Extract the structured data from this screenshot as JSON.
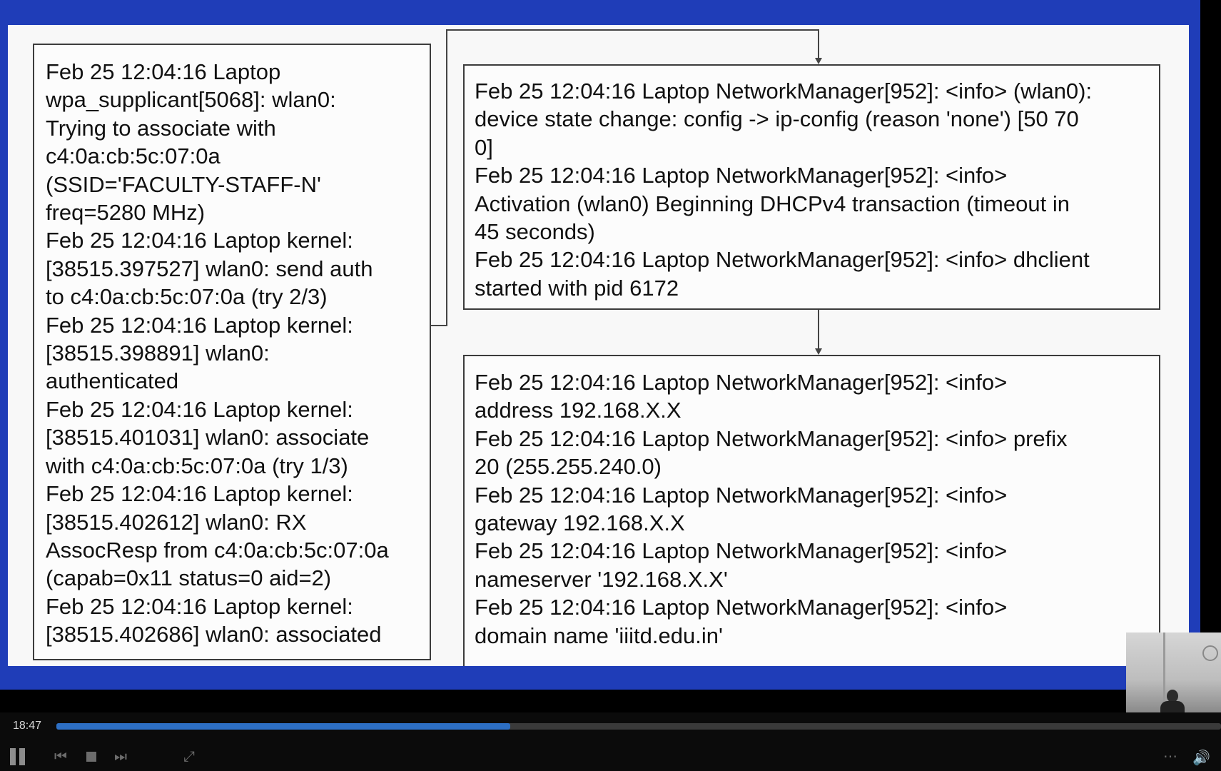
{
  "slide": {
    "left_box": [
      "Feb 25 12:04:16 Laptop",
      "wpa_supplicant[5068]: wlan0:",
      "Trying to associate with",
      "c4:0a:cb:5c:07:0a",
      "(SSID='FACULTY-STAFF-N'",
      "freq=5280 MHz)",
      "Feb 25 12:04:16 Laptop kernel:",
      "[38515.397527] wlan0: send auth",
      "to c4:0a:cb:5c:07:0a (try 2/3)",
      "Feb 25 12:04:16 Laptop kernel:",
      "[38515.398891] wlan0:",
      "authenticated",
      "Feb 25 12:04:16 Laptop kernel:",
      "[38515.401031] wlan0: associate",
      "with c4:0a:cb:5c:07:0a (try 1/3)",
      "Feb 25 12:04:16 Laptop kernel:",
      "[38515.402612] wlan0: RX",
      "AssocResp from c4:0a:cb:5c:07:0a",
      "(capab=0x11 status=0 aid=2)",
      "Feb 25 12:04:16 Laptop kernel:",
      "[38515.402686] wlan0: associated"
    ],
    "top_right_box": [
      "Feb 25 12:04:16 Laptop NetworkManager[952]: <info> (wlan0):",
      "device state change: config -> ip-config (reason 'none') [50 70",
      "0]",
      "Feb 25 12:04:16 Laptop NetworkManager[952]: <info>",
      "Activation (wlan0) Beginning DHCPv4 transaction (timeout in",
      "45 seconds)",
      "Feb 25 12:04:16 Laptop NetworkManager[952]: <info> dhclient",
      "started with pid 6172"
    ],
    "bottom_right_box": [
      "Feb 25 12:04:16 Laptop NetworkManager[952]: <info>",
      "address 192.168.X.X",
      "Feb 25 12:04:16 Laptop NetworkManager[952]: <info>   prefix",
      "20 (255.255.240.0)",
      "Feb 25 12:04:16 Laptop NetworkManager[952]: <info>",
      "gateway 192.168.X.X",
      "Feb 25 12:04:16 Laptop NetworkManager[952]: <info>",
      "nameserver '192.168.X.X'",
      "Feb 25 12:04:16 Laptop NetworkManager[952]: <info>",
      "domain name 'iiitd.edu.in'"
    ]
  },
  "player": {
    "current_time": "18:47",
    "progress": 0.39,
    "accent_color": "#2d6fc4",
    "slide_border_color": "#1f3db8",
    "icons": {
      "pause": "pause-icon",
      "prev": "skip-back-icon",
      "stop": "stop-icon",
      "next": "skip-forward-icon",
      "fullscreen": "fullscreen-icon",
      "more": "more-icon",
      "volume": "volume-icon"
    }
  }
}
